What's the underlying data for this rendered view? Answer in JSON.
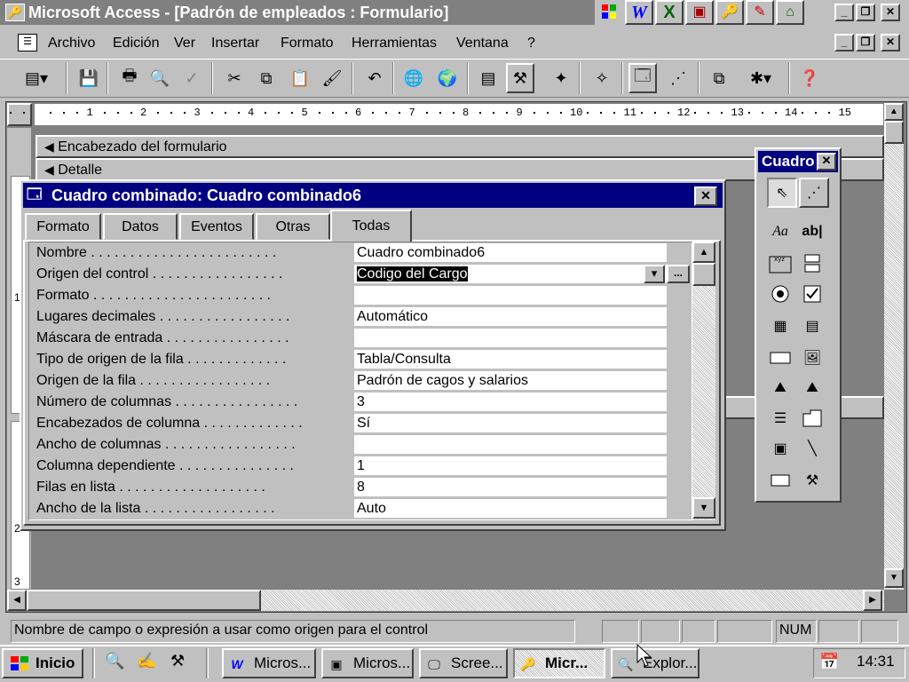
{
  "app": {
    "title": "Microsoft Access - [Padrón de empleados : Formulario]",
    "office_bar_icons": [
      "office-icon",
      "word-icon",
      "excel-icon",
      "powerpoint-icon",
      "access-icon",
      "binder-icon",
      "outlook-icon"
    ]
  },
  "window_controls": {
    "minimize": "_",
    "restore": "❐",
    "close": "✕"
  },
  "menu": {
    "items": [
      "Archivo",
      "Edición",
      "Ver",
      "Insertar",
      "Formato",
      "Herramientas",
      "Ventana",
      "?"
    ]
  },
  "toolbar": {
    "buttons": [
      "form-view",
      "save",
      "print",
      "print-preview",
      "spelling",
      "cut",
      "copy",
      "paste",
      "format-painter",
      "undo",
      "insert-hyperlink",
      "web-toolbar",
      "field-list",
      "toolbox",
      "autoformat",
      "code",
      "properties",
      "build",
      "new-object",
      "help"
    ]
  },
  "form": {
    "ruler_numbers": [
      "1",
      "2",
      "3",
      "4",
      "5",
      "6",
      "7",
      "8",
      "9",
      "10",
      "11",
      "12",
      "13",
      "14",
      "15"
    ],
    "vruler_numbers": [
      "1",
      "2",
      "3"
    ],
    "sections": {
      "header": "Encabezado del formulario",
      "detail": "Detalle"
    }
  },
  "properties": {
    "title": "Cuadro combinado: Cuadro combinado6",
    "tabs": [
      "Formato",
      "Datos",
      "Eventos",
      "Otras",
      "Todas"
    ],
    "active_tab": "Todas",
    "rows": [
      {
        "label": "Nombre . . . . . . . . . . . . . . . . . . . . . . . .",
        "value": "Cuadro combinado6"
      },
      {
        "label": "Origen del control . . . . . . . . . . . . . . . . .",
        "value": "Codigo del Cargo"
      },
      {
        "label": "Formato . . . . . . . . . . . . . . . . . . . . . . .",
        "value": ""
      },
      {
        "label": "Lugares decimales . . . . . . . . . . . . . . . . .",
        "value": "Automático"
      },
      {
        "label": "Máscara de entrada . . . . . . . . . . . . . . . .",
        "value": ""
      },
      {
        "label": "Tipo de origen de la fila . . . . . . . . . . . . .",
        "value": "Tabla/Consulta"
      },
      {
        "label": "Origen de la fila . . . . . . . . . . . . . . . . .",
        "value": "Padrón de cagos y salarios"
      },
      {
        "label": "Número de columnas . . . . . . . . . . . . . . . .",
        "value": "3"
      },
      {
        "label": "Encabezados de columna . . . . . . . . . . . . .",
        "value": "Sí"
      },
      {
        "label": "Ancho de columnas . . . . . . . . . . . . . . . . .",
        "value": ""
      },
      {
        "label": "Columna dependiente . . . . . . . . . . . . . . .",
        "value": "1"
      },
      {
        "label": "Filas en lista . . . . . . . . . . . . . . . . . . .",
        "value": "8"
      },
      {
        "label": "Ancho de la lista . . . . . . . . . . . . . . . . .",
        "value": "Auto"
      }
    ],
    "dropdown_arrow": "▾",
    "builder_button": "..."
  },
  "toolbox": {
    "title": "Cuadro",
    "close": "✕",
    "tools": [
      "select-objects",
      "control-wizards",
      "label",
      "text-box",
      "option-group",
      "toggle-button",
      "option-button",
      "check-box",
      "combo-box",
      "list-box",
      "command-button",
      "image",
      "unbound-object-frame",
      "bound-object-frame",
      "page-break",
      "tab-control",
      "subform",
      "line",
      "rectangle",
      "more-controls"
    ],
    "label_glyph": "Aa",
    "textbox_glyph": "ab|"
  },
  "status": {
    "message": "Nombre de campo o expresión a usar como origen para el control",
    "num": "NUM"
  },
  "taskbar": {
    "start": "Inicio",
    "buttons": [
      {
        "label": "Micros...",
        "icon": "word-icon"
      },
      {
        "label": "Micros...",
        "icon": "powerpoint-icon"
      },
      {
        "label": "Scree...",
        "icon": "screen-icon"
      },
      {
        "label": "Micr...",
        "icon": "access-icon",
        "active": true
      },
      {
        "label": "Explor...",
        "icon": "explorer-icon"
      }
    ],
    "clock": "14:31"
  },
  "colors": {
    "title_active": "#000080",
    "title_inactive": "#808080",
    "face": "#c0c0c0",
    "workspace": "#808080"
  }
}
